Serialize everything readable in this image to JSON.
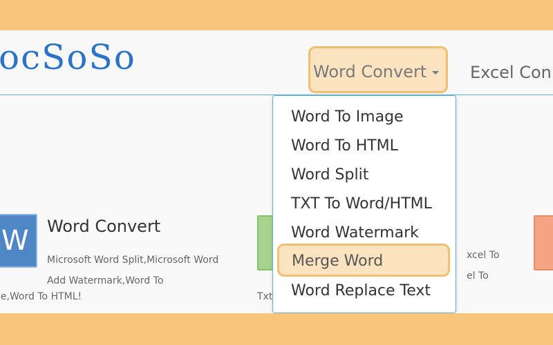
{
  "logo": {
    "text": "ocSoSo"
  },
  "nav": {
    "word_convert": "Word Convert",
    "excel_label": "Excel Con"
  },
  "dropdown": {
    "items": [
      "Word To Image",
      "Word To HTML",
      "Word Split",
      "TXT To Word/HTML",
      "Word Watermark",
      "Merge Word",
      "Word Replace Text"
    ]
  },
  "card": {
    "title": "Word Convert",
    "desc": "Microsoft Word Split,Microsoft Word Add Watermark,Word To",
    "desc_tail": "ge,Word To HTML!"
  },
  "excel_card": {
    "line1": "xcel To",
    "line2": "el To",
    "line3": "Txt"
  },
  "icons": {
    "word_icon_glyph": "W"
  },
  "colors": {
    "highlight_border": "#f3bf6e",
    "highlight_fill": "#fbe3bf",
    "accent": "#5bb3df",
    "logo": "#2a73c9"
  }
}
